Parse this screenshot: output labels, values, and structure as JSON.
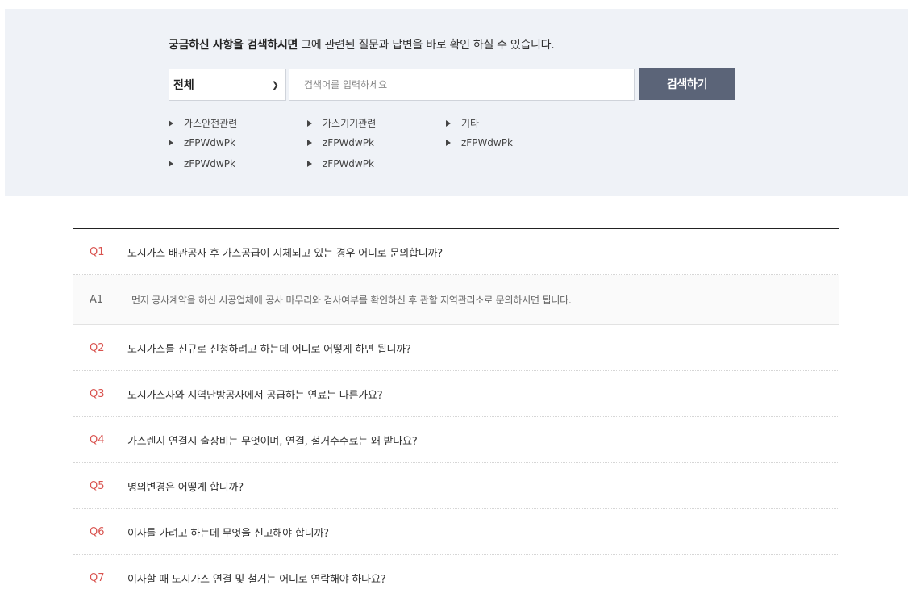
{
  "search": {
    "intro_bold": "궁금하신 사항을 검색하시면",
    "intro_rest": " 그에 관련된 질문과 답변을 바로 확인 하실 수 있습니다.",
    "category_value": "전체",
    "placeholder": "검색어를 입력하세요",
    "button_label": "검색하기"
  },
  "quick_links": [
    "가스안전관련",
    "가스기기관련",
    "기타",
    "zFPWdwPk",
    "zFPWdwPk",
    "zFPWdwPk",
    "zFPWdwPk",
    "zFPWdwPk"
  ],
  "faq": [
    {
      "num": "Q1",
      "text": "도시가스 배관공사 후 가스공급이 지체되고 있는 경우 어디로 문의합니까?"
    },
    {
      "num": "A1",
      "text": "먼저 공사계약을 하신 시공업체에 공사 마무리와 검사여부를 확인하신 후 관할 지역관리소로 문의하시면 됩니다."
    },
    {
      "num": "Q2",
      "text": "도시가스를 신규로 신청하려고 하는데 어디로 어떻게 하면 됩니까?"
    },
    {
      "num": "Q3",
      "text": "도시가스사와 지역난방공사에서 공급하는 연료는 다른가요?"
    },
    {
      "num": "Q4",
      "text": "가스렌지 연결시 출장비는 무엇이며, 연결, 철거수수료는 왜 받나요?"
    },
    {
      "num": "Q5",
      "text": "명의변경은 어떻게 합니까?"
    },
    {
      "num": "Q6",
      "text": "이사를 가려고 하는데 무엇을 신고해야 합니까?"
    },
    {
      "num": "Q7",
      "text": "이사할 때 도시가스 연결 및 철거는 어디로 연락해야 하나요?"
    }
  ]
}
